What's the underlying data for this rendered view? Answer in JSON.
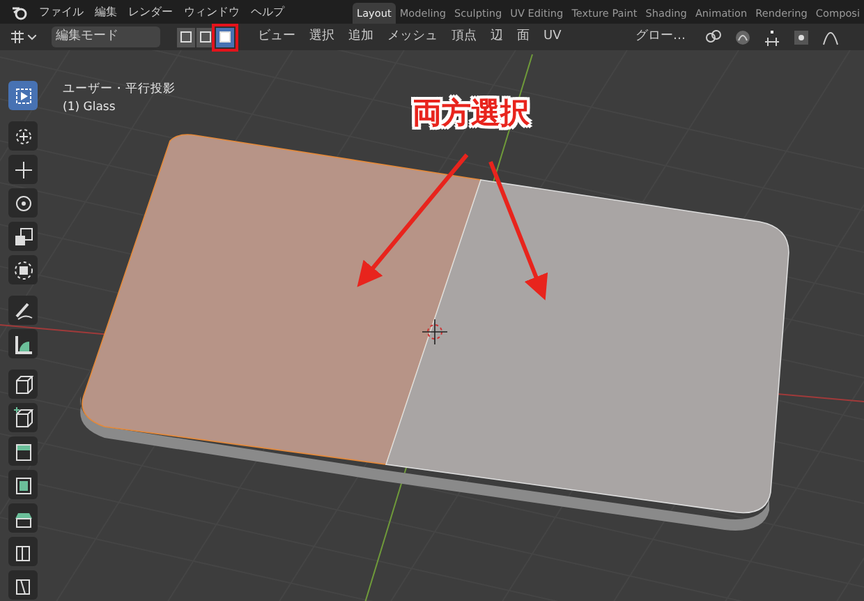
{
  "menu": [
    "ファイル",
    "編集",
    "レンダー",
    "ウィンドウ",
    "ヘルプ"
  ],
  "workspace_tabs": [
    {
      "label": "Layout",
      "selected": true
    },
    {
      "label": "Modeling",
      "selected": false
    },
    {
      "label": "Sculpting",
      "selected": false
    },
    {
      "label": "UV Editing",
      "selected": false
    },
    {
      "label": "Texture Paint",
      "selected": false
    },
    {
      "label": "Shading",
      "selected": false
    },
    {
      "label": "Animation",
      "selected": false
    },
    {
      "label": "Rendering",
      "selected": false
    },
    {
      "label": "Composi",
      "selected": false
    }
  ],
  "header": {
    "mode": "編集モード",
    "select_modes": [
      {
        "selected": false,
        "highlighted": false
      },
      {
        "selected": false,
        "highlighted": false
      },
      {
        "selected": true,
        "highlighted": true
      }
    ],
    "menus": [
      "ビュー",
      "選択",
      "追加",
      "メッシュ",
      "頂点",
      "辺",
      "面",
      "UV"
    ],
    "orientation": "グロー…"
  },
  "viewport": {
    "view_name": "ユーザー・平行投影",
    "object_name": "(1) Glass",
    "annotation": "両方選択",
    "faces": [
      {
        "selected": true
      },
      {
        "selected": false
      }
    ]
  },
  "tools": [
    {
      "selected": true
    },
    {
      "selected": false
    },
    {
      "selected": false
    },
    {
      "selected": false
    },
    {
      "selected": false
    },
    {
      "selected": false
    },
    {
      "selected": false
    },
    {
      "selected": false
    },
    {
      "selected": false
    },
    {
      "selected": false
    },
    {
      "selected": false
    },
    {
      "selected": false
    },
    {
      "selected": false
    },
    {
      "selected": false
    },
    {
      "selected": false
    }
  ]
}
